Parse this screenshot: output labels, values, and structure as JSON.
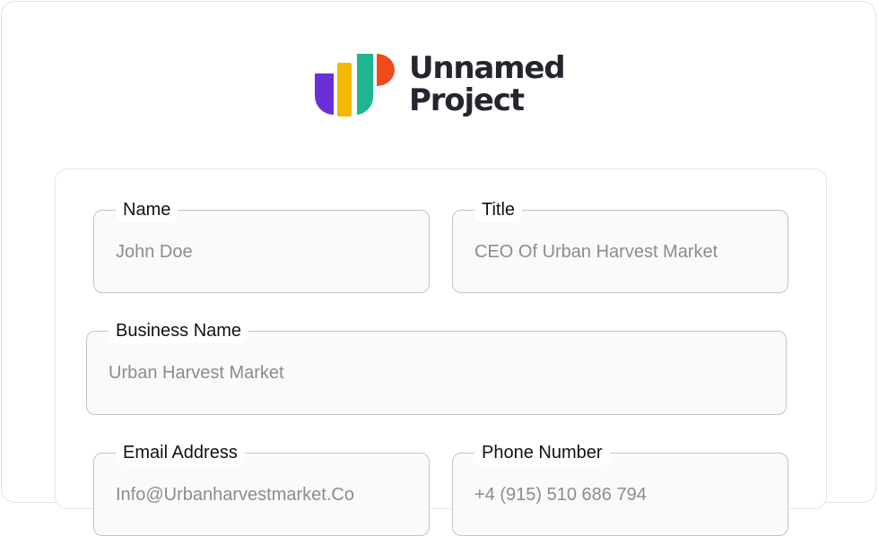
{
  "brand": {
    "name_line1": "Unnamed",
    "name_line2": "Project",
    "logo_colors": [
      "#6a2fd6",
      "#f5b800",
      "#1fb58f",
      "#f04a1a"
    ]
  },
  "form": {
    "name": {
      "label": "Name",
      "value": "John Doe"
    },
    "title": {
      "label": "Title",
      "value": "CEO Of Urban Harvest Market"
    },
    "business_name": {
      "label": "Business Name",
      "value": "Urban Harvest Market"
    },
    "email": {
      "label": "Email Address",
      "value": "Info@Urbanharvestmarket.Co"
    },
    "phone": {
      "label": "Phone Number",
      "value": "+4 (915) 510 686 794"
    }
  }
}
